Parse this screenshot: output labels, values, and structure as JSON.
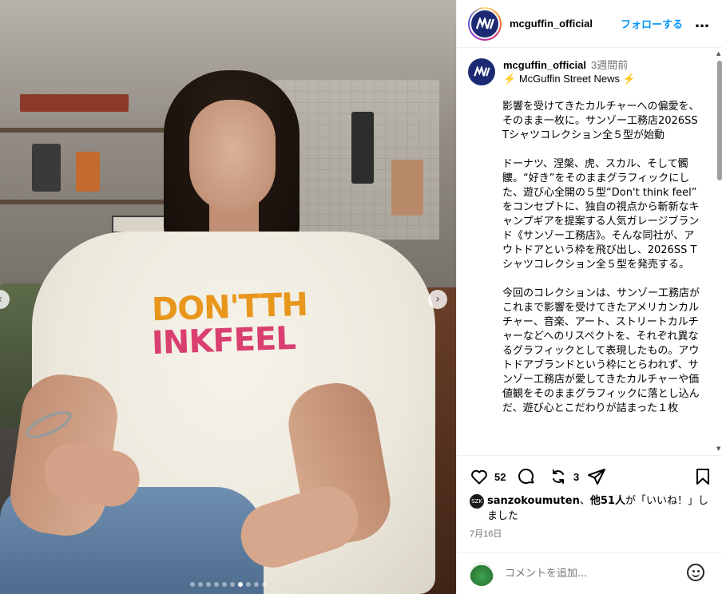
{
  "photo": {
    "shirt_text_line1": "DON'TTH",
    "shirt_text_line2": "INKFEEL",
    "carousel": {
      "total_slides": 10,
      "active_index": 6
    }
  },
  "header": {
    "username": "mcguffin_official",
    "avatar_text": "McGuffin",
    "follow_label": "フォローする",
    "more_icon": "…"
  },
  "post": {
    "username": "mcguffin_official",
    "time_ago": "3週間前",
    "subtitle": "McGuffin Street News",
    "subtitle_icon": "⚡",
    "caption": "影響を受けてきたカルチャーへの偏愛を、そのまま一枚に。サンゾー工務店2026SS Tシャツコレクション全５型が始動\n\nドーナツ、涅槃、虎、スカル、そして髑髏。“好き”をそのままグラフィックにした、遊び心全開の５型“Don't think feel” をコンセプトに、独自の視点から斬新なキャンプギアを提案する人気ガレージブランド《サンゾー工務店》。そんな同社が、アウトドアという枠を飛び出し、2026SS Tシャツコレクション全５型を発売する。\n\n今回のコレクションは、サンゾー工務店がこれまで影響を受けてきたアメリカンカルチャー、音楽、アート、ストリートカルチャーなどへのリスペクトを、それぞれ異なるグラフィックとして表現したもの。アウトドアブランドという枠にとらわれず、サンゾー工務店が愛してきたカルチャーや価値観をそのままグラフィックに落とし込んだ、遊び心とこだわりが詰まった１枚"
  },
  "actions": {
    "like_count": "52",
    "repost_count": "3"
  },
  "likes": {
    "user": "sanzokoumuten",
    "others": "他51人",
    "suffix": "が「いいね！」しました",
    "avatar_text": "SZK"
  },
  "date": "7月16日",
  "comment": {
    "placeholder": "コメントを追加..."
  }
}
